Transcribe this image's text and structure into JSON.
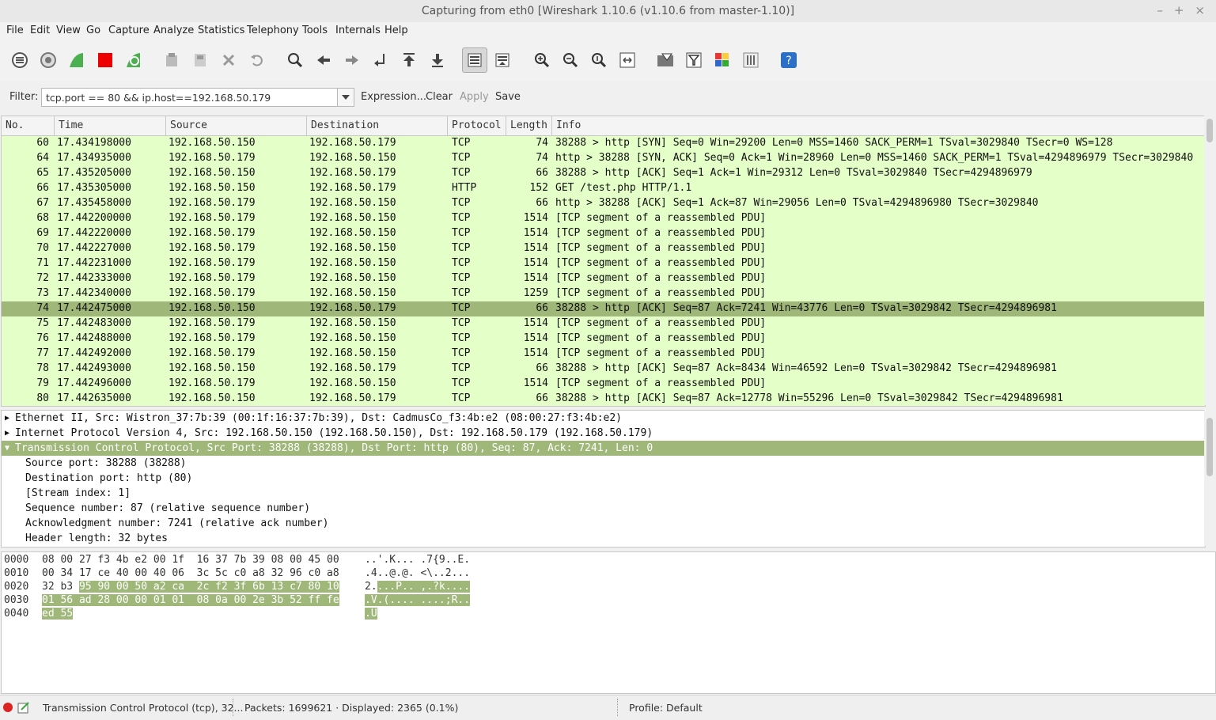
{
  "window": {
    "title": "Capturing from eth0   [Wireshark 1.10.6  (v1.10.6 from master-1.10)]",
    "minimize": "–",
    "maximize": "+",
    "close": "×"
  },
  "menu": [
    "File",
    "Edit",
    "View",
    "Go",
    "Capture",
    "Analyze",
    "Statistics",
    "Telephony",
    "Tools",
    "Internals",
    "Help"
  ],
  "filter": {
    "label": "Filter:",
    "value": "tcp.port == 80 && ip.host==192.168.50.179",
    "expression": "Expression...",
    "clear": "Clear",
    "apply": "Apply",
    "save": "Save"
  },
  "packet_list": {
    "columns": [
      "No.",
      "Time",
      "Source",
      "Destination",
      "Protocol",
      "Length",
      "Info"
    ],
    "rows": [
      {
        "no": "60",
        "time": "17.434198000",
        "src": "192.168.50.150",
        "dst": "192.168.50.179",
        "proto": "TCP",
        "len": "74",
        "info": "38288 > http [SYN] Seq=0 Win=29200 Len=0 MSS=1460 SACK_PERM=1 TSval=3029840 TSecr=0 WS=128"
      },
      {
        "no": "64",
        "time": "17.434935000",
        "src": "192.168.50.179",
        "dst": "192.168.50.150",
        "proto": "TCP",
        "len": "74",
        "info": "http > 38288 [SYN, ACK] Seq=0 Ack=1 Win=28960 Len=0 MSS=1460 SACK_PERM=1 TSval=4294896979 TSecr=3029840"
      },
      {
        "no": "65",
        "time": "17.435205000",
        "src": "192.168.50.150",
        "dst": "192.168.50.179",
        "proto": "TCP",
        "len": "66",
        "info": "38288 > http [ACK] Seq=1 Ack=1 Win=29312 Len=0 TSval=3029840 TSecr=4294896979"
      },
      {
        "no": "66",
        "time": "17.435305000",
        "src": "192.168.50.150",
        "dst": "192.168.50.179",
        "proto": "HTTP",
        "len": "152",
        "info": "GET /test.php HTTP/1.1"
      },
      {
        "no": "67",
        "time": "17.435458000",
        "src": "192.168.50.179",
        "dst": "192.168.50.150",
        "proto": "TCP",
        "len": "66",
        "info": "http > 38288 [ACK] Seq=1 Ack=87 Win=29056 Len=0 TSval=4294896980 TSecr=3029840"
      },
      {
        "no": "68",
        "time": "17.442200000",
        "src": "192.168.50.179",
        "dst": "192.168.50.150",
        "proto": "TCP",
        "len": "1514",
        "info": "[TCP segment of a reassembled PDU]"
      },
      {
        "no": "69",
        "time": "17.442220000",
        "src": "192.168.50.179",
        "dst": "192.168.50.150",
        "proto": "TCP",
        "len": "1514",
        "info": "[TCP segment of a reassembled PDU]"
      },
      {
        "no": "70",
        "time": "17.442227000",
        "src": "192.168.50.179",
        "dst": "192.168.50.150",
        "proto": "TCP",
        "len": "1514",
        "info": "[TCP segment of a reassembled PDU]"
      },
      {
        "no": "71",
        "time": "17.442231000",
        "src": "192.168.50.179",
        "dst": "192.168.50.150",
        "proto": "TCP",
        "len": "1514",
        "info": "[TCP segment of a reassembled PDU]"
      },
      {
        "no": "72",
        "time": "17.442333000",
        "src": "192.168.50.179",
        "dst": "192.168.50.150",
        "proto": "TCP",
        "len": "1514",
        "info": "[TCP segment of a reassembled PDU]"
      },
      {
        "no": "73",
        "time": "17.442340000",
        "src": "192.168.50.179",
        "dst": "192.168.50.150",
        "proto": "TCP",
        "len": "1259",
        "info": "[TCP segment of a reassembled PDU]"
      },
      {
        "no": "74",
        "time": "17.442475000",
        "src": "192.168.50.150",
        "dst": "192.168.50.179",
        "proto": "TCP",
        "len": "66",
        "info": "38288 > http [ACK] Seq=87 Ack=7241 Win=43776 Len=0 TSval=3029842 TSecr=4294896981",
        "selected": true
      },
      {
        "no": "75",
        "time": "17.442483000",
        "src": "192.168.50.179",
        "dst": "192.168.50.150",
        "proto": "TCP",
        "len": "1514",
        "info": "[TCP segment of a reassembled PDU]"
      },
      {
        "no": "76",
        "time": "17.442488000",
        "src": "192.168.50.179",
        "dst": "192.168.50.150",
        "proto": "TCP",
        "len": "1514",
        "info": "[TCP segment of a reassembled PDU]"
      },
      {
        "no": "77",
        "time": "17.442492000",
        "src": "192.168.50.179",
        "dst": "192.168.50.150",
        "proto": "TCP",
        "len": "1514",
        "info": "[TCP segment of a reassembled PDU]"
      },
      {
        "no": "78",
        "time": "17.442493000",
        "src": "192.168.50.150",
        "dst": "192.168.50.179",
        "proto": "TCP",
        "len": "66",
        "info": "38288 > http [ACK] Seq=87 Ack=8434 Win=46592 Len=0 TSval=3029842 TSecr=4294896981"
      },
      {
        "no": "79",
        "time": "17.442496000",
        "src": "192.168.50.179",
        "dst": "192.168.50.150",
        "proto": "TCP",
        "len": "1514",
        "info": "[TCP segment of a reassembled PDU]"
      },
      {
        "no": "80",
        "time": "17.442635000",
        "src": "192.168.50.150",
        "dst": "192.168.50.179",
        "proto": "TCP",
        "len": "66",
        "info": "38288 > http [ACK] Seq=87 Ack=12778 Win=55296 Len=0 TSval=3029842 TSecr=4294896981"
      }
    ]
  },
  "details": [
    {
      "text": "Ethernet II, Src: Wistron_37:7b:39 (00:1f:16:37:7b:39), Dst: CadmusCo_f3:4b:e2 (08:00:27:f3:4b:e2)",
      "expander": "collapsed"
    },
    {
      "text": "Internet Protocol Version 4, Src: 192.168.50.150 (192.168.50.150), Dst: 192.168.50.179 (192.168.50.179)",
      "expander": "collapsed"
    },
    {
      "text": "Transmission Control Protocol, Src Port: 38288 (38288), Dst Port: http (80), Seq: 87, Ack: 7241, Len: 0",
      "expander": "expanded",
      "selected": true
    },
    {
      "text": "Source port: 38288 (38288)",
      "child": true
    },
    {
      "text": "Destination port: http (80)",
      "child": true
    },
    {
      "text": "[Stream index: 1]",
      "child": true
    },
    {
      "text": "Sequence number: 87    (relative sequence number)",
      "child": true
    },
    {
      "text": "Acknowledgment number: 7241    (relative ack number)",
      "child": true
    },
    {
      "text": "Header length: 32 bytes",
      "child": true
    }
  ],
  "hex": [
    {
      "offset": "0000",
      "plain": "08 00 27 f3 4b e2 00 1f  16 37 7b 39 08 00 45 00",
      "hl": "",
      "ascii_plain": "..'.K... .7{9..E.",
      "ascii_hl": ""
    },
    {
      "offset": "0010",
      "plain": "00 34 17 ce 40 00 40 06  3c 5c c0 a8 32 96 c0 a8",
      "hl": "",
      "ascii_plain": ".4..@.@. <\\..2...",
      "ascii_hl": ""
    },
    {
      "offset": "0020",
      "plain": "32 b3 ",
      "hl": "95 90 00 50 a2 ca  2c f2 3f 6b 13 c7 80 10",
      "ascii_plain": "2.",
      "ascii_hl": "...P.. ,.?k...."
    },
    {
      "offset": "0030",
      "plain": "",
      "hl": "01 56 ad 28 00 00 01 01  08 0a 00 2e 3b 52 ff fe",
      "ascii_plain": "",
      "ascii_hl": ".V.(.... ....;R.."
    },
    {
      "offset": "0040",
      "plain": "",
      "hl": "ed 55",
      "ascii_plain": "",
      "ascii_hl": ".U"
    }
  ],
  "status": {
    "expert": "Transmission Control Protocol (tcp), 32...",
    "packets": "Packets: 1699621 · Displayed: 2365 (0.1%)",
    "profile": "Profile: Default"
  },
  "colors": {
    "row_bg": "#e4ffc7",
    "selected_bg": "#9fb879"
  },
  "icons": [
    "interfaces-icon",
    "options-icon",
    "start-capture-icon",
    "stop-capture-icon",
    "restart-capture-icon",
    "open-file-icon",
    "save-file-icon",
    "close-file-icon",
    "reload-icon",
    "find-packet-icon",
    "go-back-icon",
    "go-forward-icon",
    "go-to-packet-icon",
    "go-first-icon",
    "go-last-icon",
    "colorize-icon",
    "autoscroll-icon",
    "zoom-in-icon",
    "zoom-out-icon",
    "normal-size-icon",
    "resize-columns-icon",
    "capture-filters-icon",
    "display-filters-icon",
    "coloring-rules-icon",
    "preferences-icon",
    "help-icon"
  ]
}
